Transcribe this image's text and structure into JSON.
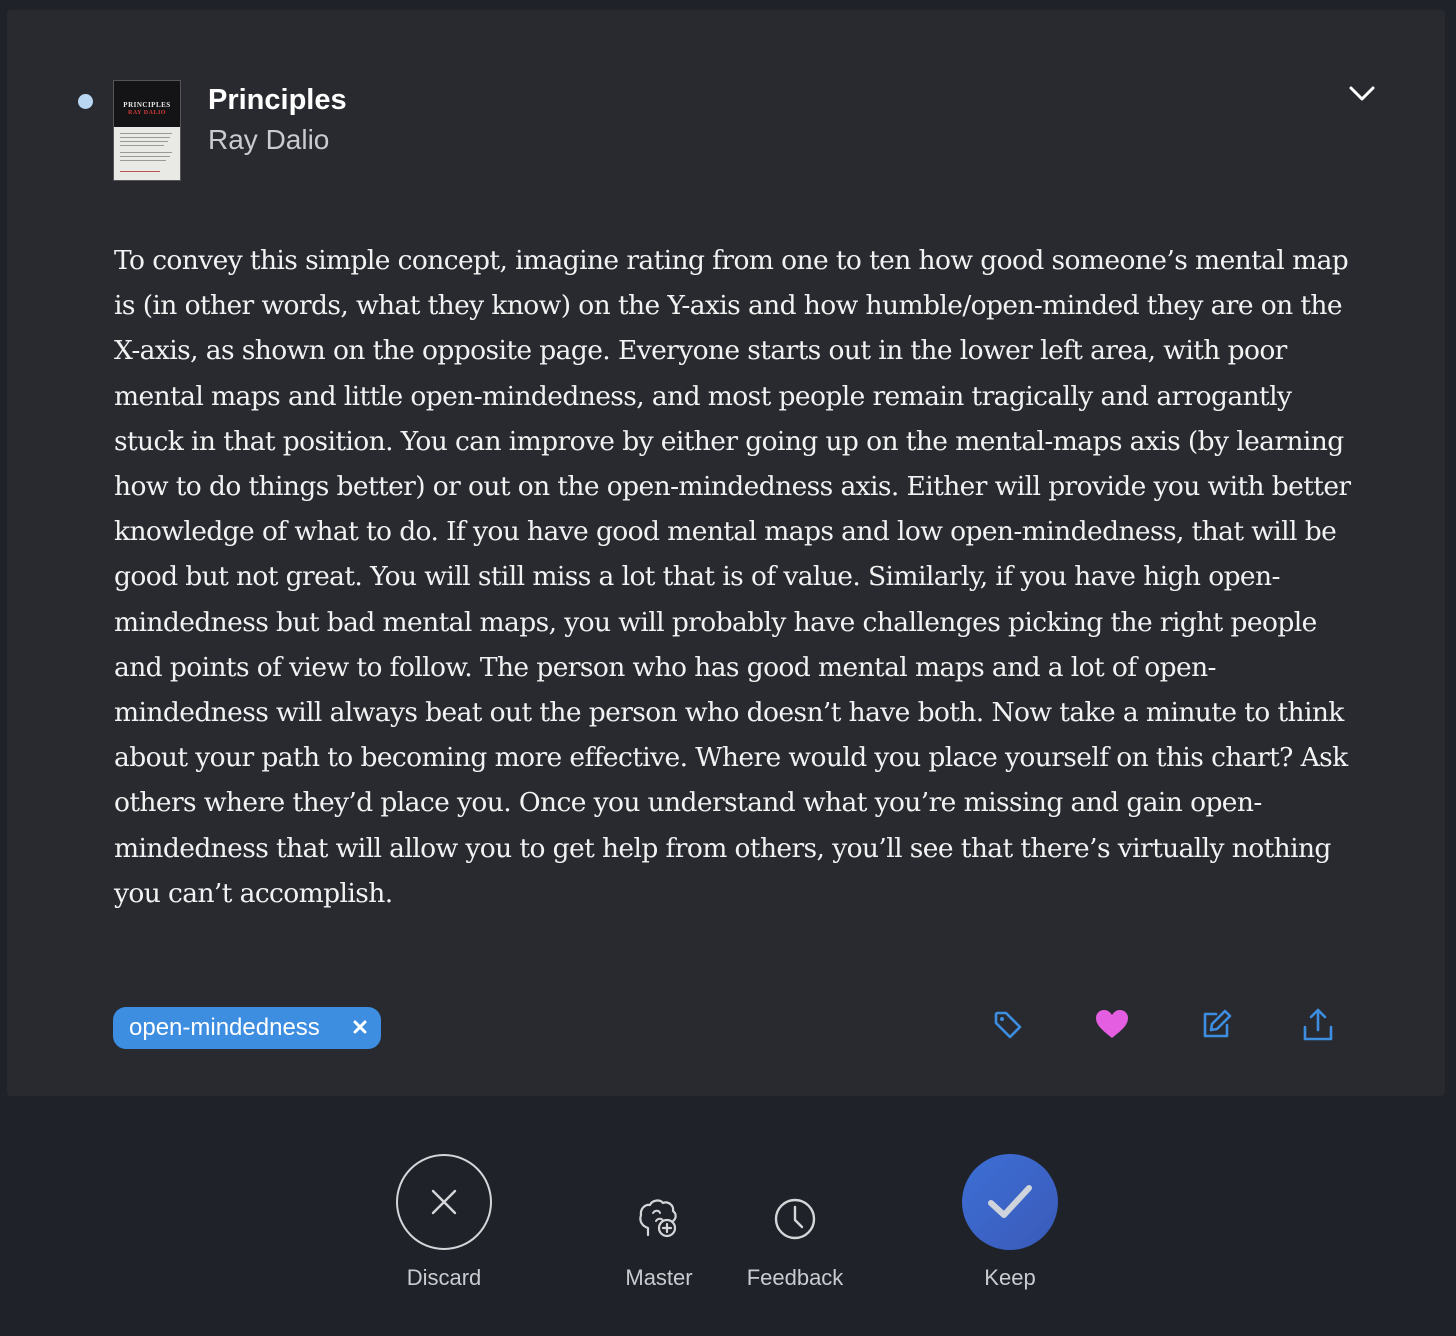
{
  "book": {
    "title": "Principles",
    "author": "Ray Dalio",
    "cover_title": "PRINCIPLES",
    "cover_author": "RAY DALIO"
  },
  "highlight": {
    "text": "To convey this simple concept, imagine rating from one to ten how good someone’s mental map is (in other words, what they know) on the Y-axis and how humble/open-minded they are on the X-axis, as shown on the opposite page. Everyone starts out in the lower left area, with poor mental maps and little open-mindedness, and most people remain tragically and arrogantly stuck in that position. You can improve by either going up on the mental-maps axis (by learning how to do things better) or out on the open-mindedness axis. Either will provide you with better knowledge of what to do. If you have good mental maps and low open-mindedness, that will be good but not great. You will still miss a lot that is of value. Similarly, if you have high open-mindedness but bad mental maps, you will probably have challenges picking the right people and points of view to follow. The person who has good mental maps and a lot of open-mindedness will always beat out the person who doesn’t have both. Now take a minute to think about your path to becoming more effective. Where would you place yourself on this chart? Ask others where they’d place you. Once you understand what you’re missing and gain open-mindedness that will allow you to get help from others, you’ll see that there’s virtually nothing you can’t accomplish."
  },
  "tags": [
    {
      "label": "open-mindedness"
    }
  ],
  "actions": {
    "icons": [
      "tag-icon",
      "heart-icon",
      "edit-icon",
      "share-icon"
    ],
    "favorite_color": "#e35ee0",
    "accent_color": "#3d8de0"
  },
  "bottom_bar": {
    "discard_label": "Discard",
    "master_label": "Master",
    "feedback_label": "Feedback",
    "keep_label": "Keep"
  },
  "colors": {
    "background": "#1f2228",
    "card": "#282a30",
    "keep_button": "#3d63c8",
    "unread_dot": "#b9d7f2"
  }
}
